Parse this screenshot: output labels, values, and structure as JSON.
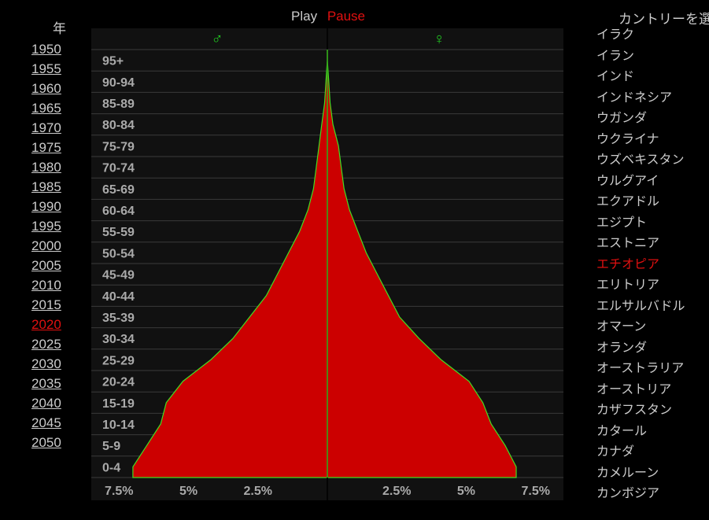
{
  "controls": {
    "play_label": "Play",
    "pause_label": "Pause"
  },
  "years": {
    "heading": "年",
    "items": [
      "1950",
      "1955",
      "1960",
      "1965",
      "1970",
      "1975",
      "1980",
      "1985",
      "1990",
      "1995",
      "2000",
      "2005",
      "2010",
      "2015",
      "2020",
      "2025",
      "2030",
      "2035",
      "2040",
      "2045",
      "2050"
    ],
    "selected": "2020"
  },
  "countries": {
    "heading": "カントリーを選",
    "items": [
      "イラク",
      "イラン",
      "インド",
      "インドネシア",
      "ウガンダ",
      "ウクライナ",
      "ウズベキスタン",
      "ウルグアイ",
      "エクアドル",
      "エジプト",
      "エストニア",
      "エチオピア",
      "エリトリア",
      "エルサルバドル",
      "オマーン",
      "オランダ",
      "オーストラリア",
      "オーストリア",
      "カザフスタン",
      "カタール",
      "カナダ",
      "カメルーン",
      "カンボジア"
    ],
    "selected": "エチオピア"
  },
  "colors": {
    "fill": "#cc0000",
    "outline": "#44dd22",
    "male_symbol": "#22cc22",
    "female_symbol": "#22cc22",
    "background": "#111111",
    "grid": "#3a3a3a"
  },
  "chart_data": {
    "type": "area",
    "orientation": "horizontal population pyramid",
    "male_symbol": "♂",
    "female_symbol": "♀",
    "age_groups": [
      "0-4",
      "5-9",
      "10-14",
      "15-19",
      "20-24",
      "25-29",
      "30-34",
      "35-39",
      "40-44",
      "45-49",
      "50-54",
      "55-59",
      "60-64",
      "65-69",
      "70-74",
      "75-79",
      "80-84",
      "85-89",
      "90-94",
      "95+"
    ],
    "x_tick_labels": [
      "7.5%",
      "5%",
      "2.5%",
      "2.5%",
      "5%",
      "7.5%"
    ],
    "xlim": [
      -8.5,
      8.5
    ],
    "x_unit": "%",
    "series": [
      {
        "name": "♂",
        "values": [
          7.0,
          6.5,
          6.0,
          5.8,
          5.2,
          4.2,
          3.4,
          2.8,
          2.2,
          1.8,
          1.4,
          1.0,
          0.7,
          0.5,
          0.4,
          0.3,
          0.2,
          0.1,
          0.05,
          0.0
        ]
      },
      {
        "name": "♀",
        "values": [
          6.8,
          6.4,
          5.9,
          5.6,
          5.1,
          4.1,
          3.3,
          2.6,
          2.2,
          1.8,
          1.4,
          1.1,
          0.8,
          0.6,
          0.5,
          0.4,
          0.2,
          0.1,
          0.05,
          0.0
        ]
      }
    ]
  }
}
